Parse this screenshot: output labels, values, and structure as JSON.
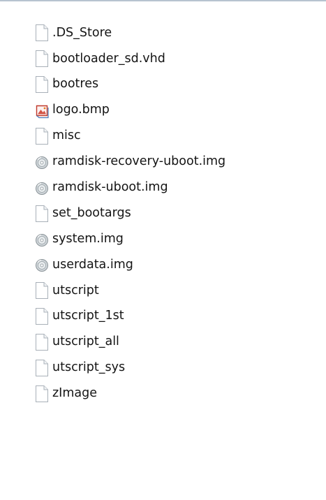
{
  "files": [
    {
      "name": ".DS_Store",
      "icon": "generic-file-icon"
    },
    {
      "name": "bootloader_sd.vhd",
      "icon": "generic-file-icon"
    },
    {
      "name": "bootres",
      "icon": "generic-file-icon"
    },
    {
      "name": "logo.bmp",
      "icon": "bitmap-image-icon"
    },
    {
      "name": "misc",
      "icon": "generic-file-icon"
    },
    {
      "name": "ramdisk-recovery-uboot.img",
      "icon": "disc-image-icon"
    },
    {
      "name": "ramdisk-uboot.img",
      "icon": "disc-image-icon"
    },
    {
      "name": "set_bootargs",
      "icon": "generic-file-icon"
    },
    {
      "name": "system.img",
      "icon": "disc-image-icon"
    },
    {
      "name": "userdata.img",
      "icon": "disc-image-icon"
    },
    {
      "name": "utscript",
      "icon": "generic-file-icon"
    },
    {
      "name": "utscript_1st",
      "icon": "generic-file-icon"
    },
    {
      "name": "utscript_all",
      "icon": "generic-file-icon"
    },
    {
      "name": "utscript_sys",
      "icon": "generic-file-icon"
    },
    {
      "name": "zImage",
      "icon": "generic-file-icon"
    }
  ],
  "colors": {
    "top_border": "#b7c3cf",
    "text": "#141414",
    "page_icon_outline": "#a8b0b8",
    "disc_icon": "#8a9398",
    "bitmap_icon_accent": "#c0392b"
  }
}
